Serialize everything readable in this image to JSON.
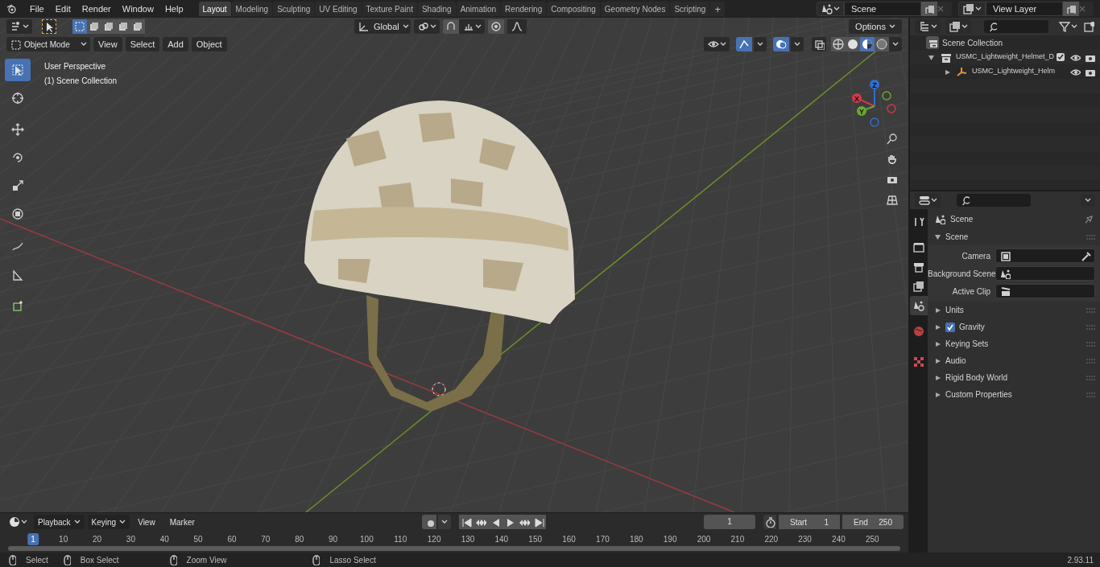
{
  "top_bar": {
    "menus": [
      "File",
      "Edit",
      "Render",
      "Window",
      "Help"
    ],
    "workspaces": [
      {
        "label": "Layout",
        "selected": true
      },
      {
        "label": "Modeling",
        "selected": false
      },
      {
        "label": "Sculpting",
        "selected": false
      },
      {
        "label": "UV Editing",
        "selected": false
      },
      {
        "label": "Texture Paint",
        "selected": false
      },
      {
        "label": "Shading",
        "selected": false
      },
      {
        "label": "Animation",
        "selected": false
      },
      {
        "label": "Rendering",
        "selected": false
      },
      {
        "label": "Compositing",
        "selected": false
      },
      {
        "label": "Geometry Nodes",
        "selected": false
      },
      {
        "label": "Scripting",
        "selected": false
      }
    ],
    "add_workspace": "+",
    "scene": "Scene",
    "view_layer": "View Layer"
  },
  "viewport": {
    "select_modes": [
      {
        "selected": true
      },
      {
        "selected": false
      },
      {
        "selected": false
      },
      {
        "selected": false
      },
      {
        "selected": false
      }
    ],
    "show_gizmo": true,
    "show_overlays": true,
    "transform_orientation": "Global",
    "options": "Options",
    "mode": "Object Mode",
    "menus": [
      "View",
      "Select",
      "Add",
      "Object"
    ],
    "shading": [
      {
        "kind": "wireframe",
        "selected": false
      },
      {
        "kind": "solid",
        "selected": false
      },
      {
        "kind": "material",
        "selected": true
      },
      {
        "kind": "rendered",
        "selected": false
      }
    ],
    "overlay_text": [
      "User Perspective",
      "(1) Scene Collection"
    ],
    "tools": [
      {
        "kind": "select",
        "selected": true
      },
      {
        "kind": "cursor",
        "selected": false
      },
      {
        "kind": "move",
        "selected": false
      },
      {
        "kind": "rotate",
        "selected": false
      },
      {
        "kind": "scale",
        "selected": false
      },
      {
        "kind": "transform",
        "selected": false
      },
      {
        "kind": "annotate",
        "selected": false
      },
      {
        "kind": "measure",
        "selected": false
      },
      {
        "kind": "add-cube",
        "selected": false
      }
    ],
    "gizmo_axes": [
      "X",
      "Y",
      "Z"
    ]
  },
  "outliner": {
    "root": "Scene Collection",
    "items": [
      {
        "label": "USMC_Lightweight_Helmet_D",
        "checked": true,
        "expanded": true,
        "children": [
          {
            "label": "USMC_Lightweight_Helm",
            "expanded": false
          }
        ]
      }
    ]
  },
  "properties": {
    "tabs": [
      {
        "kind": "tool",
        "selected": false
      },
      {
        "kind": "render",
        "selected": false
      },
      {
        "kind": "output",
        "selected": false
      },
      {
        "kind": "view-layer",
        "selected": false
      },
      {
        "kind": "scene",
        "selected": true
      },
      {
        "kind": "world",
        "selected": false
      },
      {
        "kind": "texture",
        "selected": false
      }
    ],
    "header": "Scene",
    "panels": [
      {
        "label": "Scene",
        "expanded": true,
        "fields": [
          {
            "label": "Camera",
            "kind": "camera"
          },
          {
            "label": "Background Scene",
            "kind": "scene"
          },
          {
            "label": "Active Clip",
            "kind": "clip"
          }
        ]
      },
      {
        "label": "Units",
        "expanded": false
      },
      {
        "label": "Gravity",
        "expanded": false,
        "checked": true
      },
      {
        "label": "Keying Sets",
        "expanded": false
      },
      {
        "label": "Audio",
        "expanded": false
      },
      {
        "label": "Rigid Body World",
        "expanded": false
      },
      {
        "label": "Custom Properties",
        "expanded": false
      }
    ]
  },
  "timeline": {
    "menus": [
      "Playback",
      "Keying",
      "View",
      "Marker"
    ],
    "current_frame": "1",
    "start_label": "Start",
    "start": "1",
    "end_label": "End",
    "end": "250",
    "ticks": [
      "1",
      "10",
      "20",
      "30",
      "40",
      "50",
      "60",
      "70",
      "80",
      "90",
      "100",
      "110",
      "120",
      "130",
      "140",
      "150",
      "160",
      "170",
      "180",
      "190",
      "200",
      "210",
      "220",
      "230",
      "240",
      "250"
    ]
  },
  "status_bar": {
    "hints": [
      "Select",
      "Box Select",
      "Zoom View",
      "Lasso Select"
    ],
    "version": "2.93.11"
  }
}
